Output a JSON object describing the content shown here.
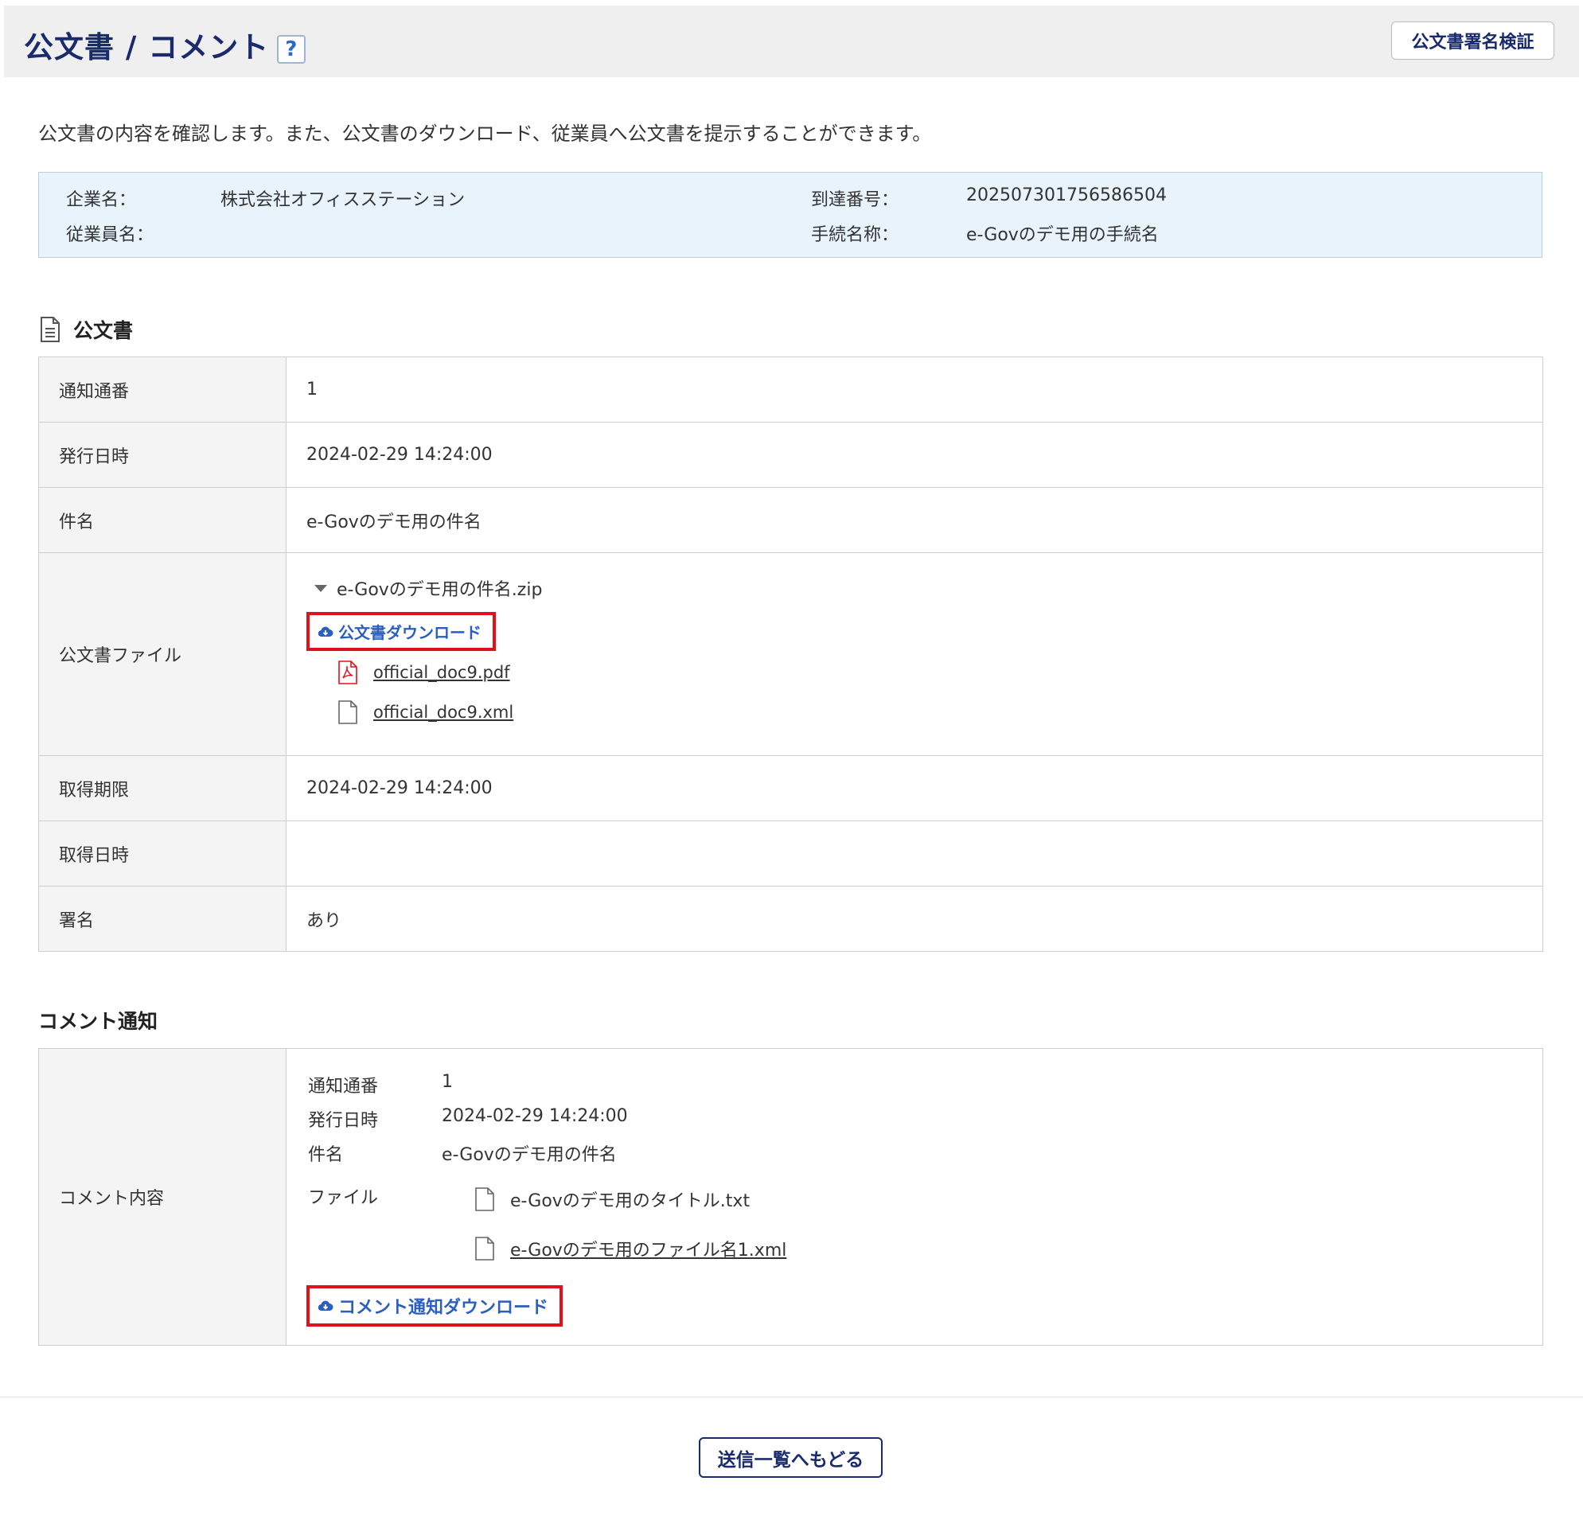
{
  "header": {
    "title": "公文書 / コメント",
    "help_label": "?",
    "verify_button": "公文書署名検証"
  },
  "description": "公文書の内容を確認します。また、公文書のダウンロード、従業員へ公文書を提示することができます。",
  "info": {
    "company_label": "企業名：",
    "company_value": "株式会社オフィスステーション",
    "employee_label": "従業員名：",
    "employee_value": "",
    "arrival_label": "到達番号：",
    "arrival_value": "202507301756586504",
    "procedure_label": "手続名称：",
    "procedure_value": "e-Govのデモ用の手続名"
  },
  "official_doc": {
    "section_title": "公文書",
    "rows": [
      {
        "label": "通知通番",
        "value": "1"
      },
      {
        "label": "発行日時",
        "value": "2024-02-29 14:24:00"
      },
      {
        "label": "件名",
        "value": "e-Govのデモ用の件名"
      }
    ],
    "file_label": "公文書ファイル",
    "zip_name": "e-Govのデモ用の件名.zip",
    "download_button": "公文書ダウンロード",
    "files": [
      "official_doc9.pdf",
      "official_doc9.xml"
    ],
    "rows_after": [
      {
        "label": "取得期限",
        "value": "2024-02-29 14:24:00"
      },
      {
        "label": "取得日時",
        "value": ""
      },
      {
        "label": "署名",
        "value": "あり"
      }
    ]
  },
  "comment": {
    "section_title": "コメント通知",
    "label": "コメント内容",
    "notice_no_label": "通知通番",
    "notice_no_value": "1",
    "issue_label": "発行日時",
    "issue_value": "2024-02-29 14:24:00",
    "subject_label": "件名",
    "subject_value": "e-Govのデモ用の件名",
    "file_label": "ファイル",
    "files": [
      "e-Govのデモ用のタイトル.txt",
      "e-Govのデモ用のファイル名1.xml"
    ],
    "download_button": "コメント通知ダウンロード"
  },
  "footer": {
    "back_button": "送信一覧へもどる"
  },
  "colors": {
    "title": "#1a2b6d",
    "link_blue": "#2a5fbd",
    "highlight_red": "#e0111b",
    "info_bg": "#e8f3fc"
  }
}
